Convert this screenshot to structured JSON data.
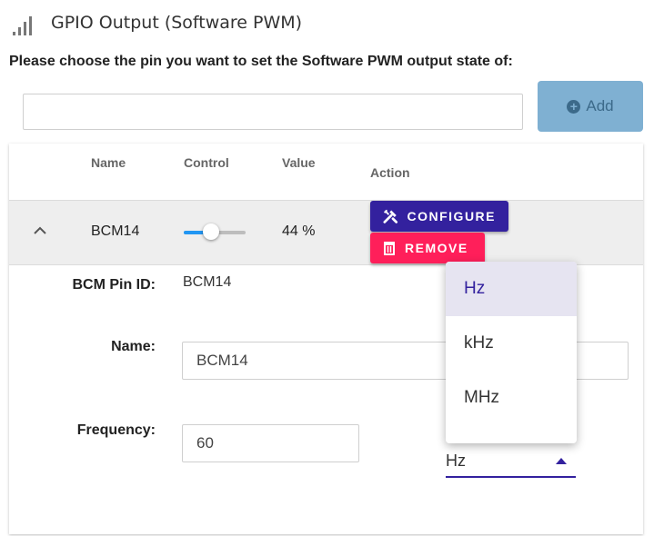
{
  "header": {
    "title": "GPIO Output (Software PWM)",
    "icon": "signal-bars-icon"
  },
  "instruction": "Please choose the pin you want to set the Software PWM output state of:",
  "pin_input": {
    "value": "",
    "placeholder": ""
  },
  "add_button": {
    "label": "Add"
  },
  "table": {
    "headers": {
      "name": "Name",
      "control": "Control",
      "value": "Value",
      "action": "Action"
    },
    "row": {
      "name": "BCM14",
      "slider_value": 44,
      "value_text": "44 %",
      "configure_label": "CONFIGURE",
      "remove_label": "REMOVE"
    }
  },
  "details": {
    "bcm_pin_label": "BCM Pin ID:",
    "bcm_pin_value": "BCM14",
    "name_label": "Name:",
    "name_value": "BCM14",
    "frequency_label": "Frequency:",
    "frequency_value": "60",
    "unit_selected": "Hz"
  },
  "unit_menu": {
    "options": [
      "Hz",
      "kHz",
      "MHz"
    ],
    "selected": "Hz"
  },
  "colors": {
    "primary": "#33219e",
    "danger": "#ff1f5a",
    "add_disabled": "#7fb0d2",
    "slider": "#2196f3"
  }
}
